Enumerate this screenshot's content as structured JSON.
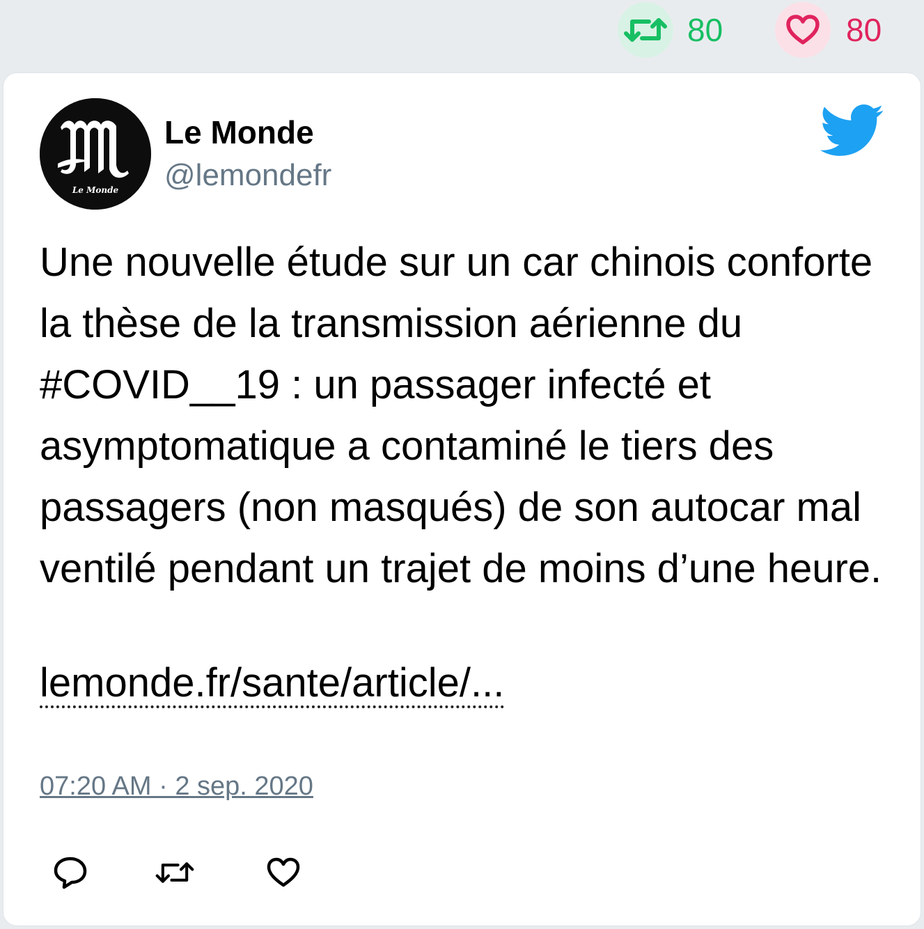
{
  "stats": {
    "retweet_count": "80",
    "like_count": "80",
    "retweet_color": "#17bf63",
    "like_color": "#e0245e"
  },
  "tweet": {
    "author_name": "Le Monde",
    "author_handle": "@lemondefr",
    "avatar_icon": "le-monde-logo",
    "avatar_text": "Le Monde",
    "platform_icon": "twitter-bird-icon",
    "text": "Une nouvelle étude sur un car chinois conforte la thèse de la transmission aérienne du #COVID__19 : un passager infecté et asymptomatique a contaminé le tiers des passagers (non masqués) de son autocar mal ventilé pendant un trajet de moins d’une heure.",
    "link": "lemonde.fr/sante/article/...",
    "timestamp": "07:20 AM · 2 sep. 2020"
  },
  "actions": {
    "reply_icon": "reply-icon",
    "retweet_icon": "retweet-icon",
    "like_icon": "heart-icon"
  },
  "colors": {
    "page_background": "#e9ecef",
    "card_background": "#ffffff",
    "handle_color": "#657786",
    "twitter_blue": "#1da1f2"
  }
}
